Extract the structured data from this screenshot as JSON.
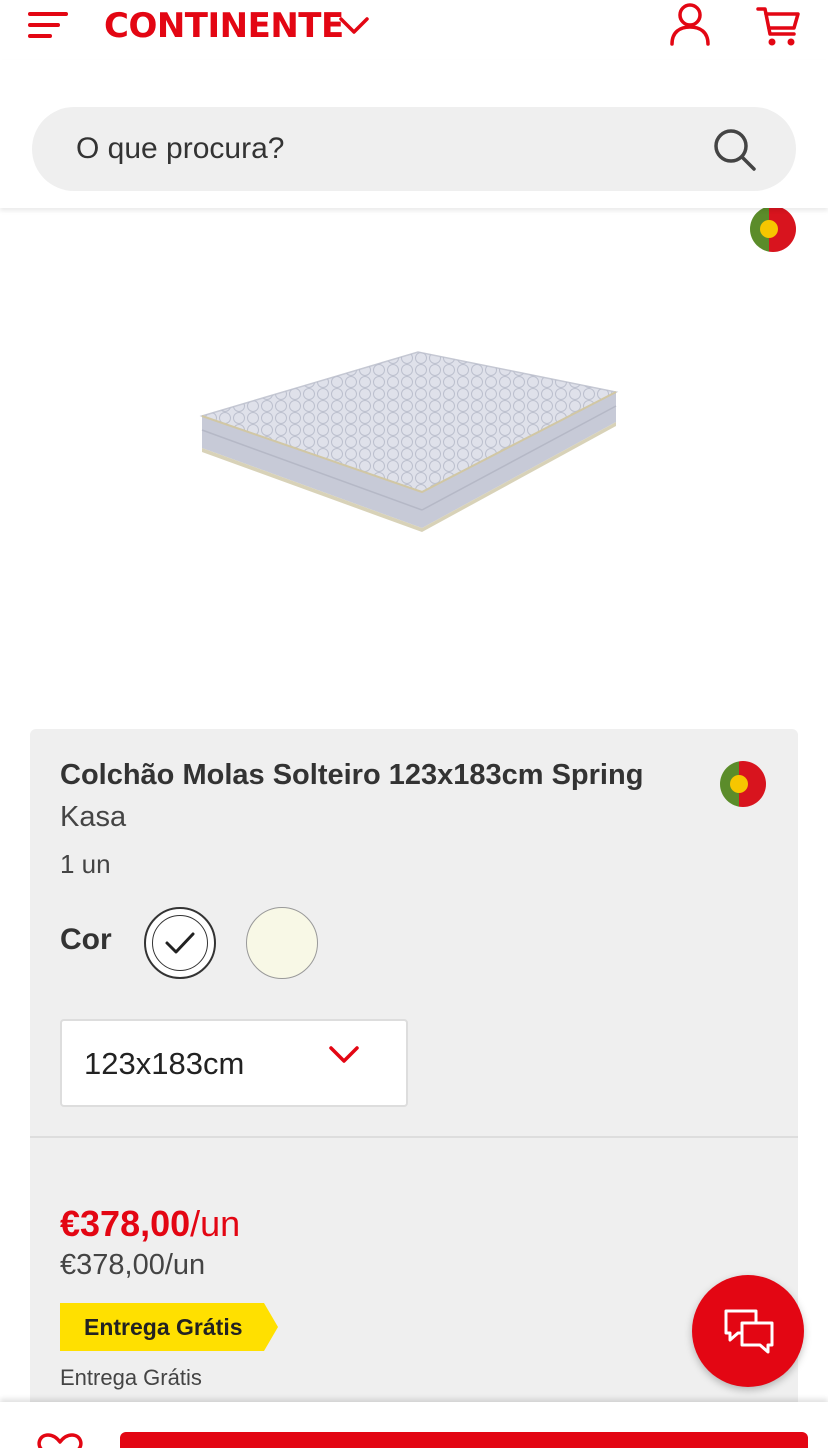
{
  "header": {
    "logo_text": "CONTINENTE",
    "icons": {
      "menu": "hamburger-menu-icon",
      "logo_dropdown": "chevron-down-icon",
      "account": "user-icon",
      "cart": "shopping-cart-icon"
    }
  },
  "search": {
    "placeholder": "O que procura?",
    "icon": "search-icon"
  },
  "product": {
    "image": "mattress",
    "origin_badge": "portugal-flag-badge",
    "title": "Colchão Molas Solteiro 123x183cm Spring",
    "brand": "Kasa",
    "quantity": "1 un",
    "color_label": "Cor",
    "colors": [
      {
        "name": "white",
        "hex": "#ffffff",
        "selected": true
      },
      {
        "name": "cream",
        "hex": "#f8f8e6",
        "selected": false
      }
    ],
    "size_selected": "123x183cm",
    "price": {
      "amount": "€378,00",
      "unit": "/un",
      "reference": "€378,00/un"
    },
    "delivery_badge": "Entrega Grátis",
    "delivery_text": "Entrega Grátis"
  },
  "chat": {
    "icon": "chat-bubbles-icon"
  },
  "bottom_bar": {
    "wishlist_icon": "heart-icon"
  },
  "colors": {
    "brand_red": "#e30613",
    "card_bg": "#efefef",
    "badge_yellow": "#ffe000"
  }
}
